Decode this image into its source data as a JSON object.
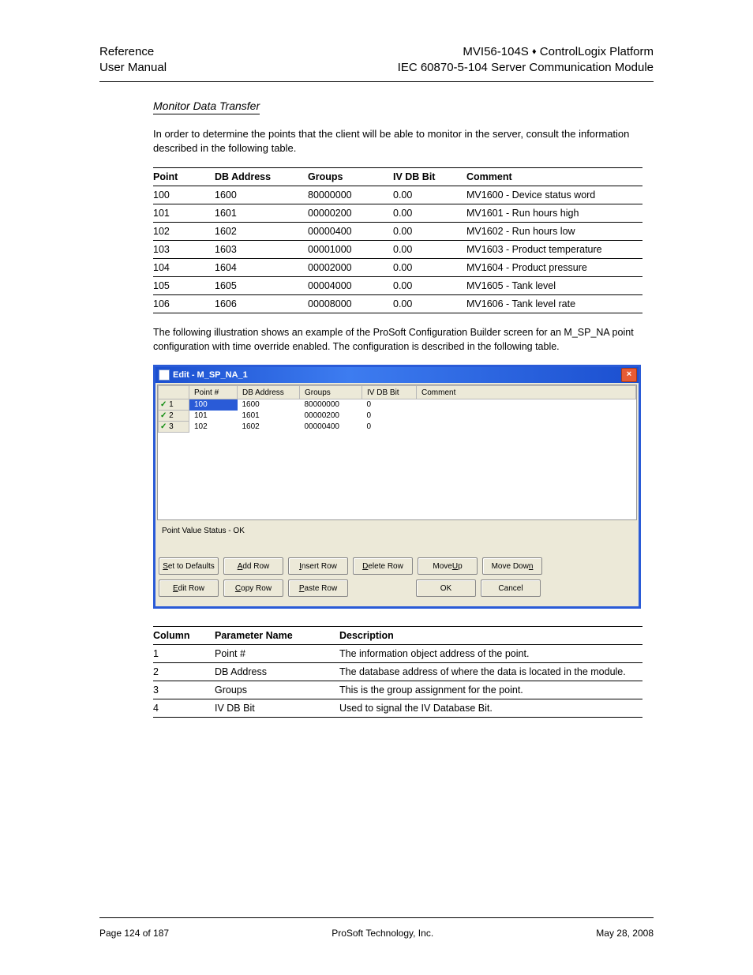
{
  "header": {
    "left1": "Reference",
    "left2": "User Manual",
    "right1_a": "MVI56-104S",
    "right1_diamond": "♦",
    "right1_b": "ControlLogix Platform",
    "right2": "IEC 60870-5-104 Server Communication Module"
  },
  "section_title": "Monitor Data Transfer",
  "para1": "In order to determine the points that the client will be able to monitor in the server, consult the information described in the following table.",
  "table1": {
    "headers": [
      "Point",
      "DB Address",
      "Groups",
      "IV DB Bit",
      "Comment"
    ],
    "rows": [
      [
        "100",
        "1600",
        "80000000",
        "0.00",
        "MV1600 - Device status word"
      ],
      [
        "101",
        "1601",
        "00000200",
        "0.00",
        "MV1601 - Run hours high"
      ],
      [
        "102",
        "1602",
        "00000400",
        "0.00",
        "MV1602 - Run hours low"
      ],
      [
        "103",
        "1603",
        "00001000",
        "0.00",
        "MV1603 - Product temperature"
      ],
      [
        "104",
        "1604",
        "00002000",
        "0.00",
        "MV1604 - Product pressure"
      ],
      [
        "105",
        "1605",
        "00004000",
        "0.00",
        "MV1605 - Tank level"
      ],
      [
        "106",
        "1606",
        "00008000",
        "0.00",
        "MV1606 - Tank level rate"
      ]
    ]
  },
  "footnote1": "The following illustration shows an example of the ProSoft Configuration Builder screen for an M_SP_NA point configuration with time override enabled. The configuration is described in the following table.",
  "window": {
    "title": "Edit - M_SP_NA_1",
    "columns": [
      "",
      "Point #",
      "DB Address",
      "Groups",
      "IV DB Bit",
      "Comment"
    ],
    "rows": [
      {
        "idx": "1",
        "point": "100",
        "db": "1600",
        "groups": "80000000",
        "iv": "0",
        "comment": "",
        "selected": true
      },
      {
        "idx": "2",
        "point": "101",
        "db": "1601",
        "groups": "00000200",
        "iv": "0",
        "comment": ""
      },
      {
        "idx": "3",
        "point": "102",
        "db": "1602",
        "groups": "00000400",
        "iv": "0",
        "comment": ""
      }
    ],
    "status": "Point Value Status - OK",
    "buttons_row1": [
      "Set to Defaults",
      "Add Row",
      "Insert Row",
      "Delete Row",
      "Move Up",
      "Move Down"
    ],
    "buttons_row2": [
      "Edit Row",
      "Copy Row",
      "Paste Row",
      "",
      "OK",
      "Cancel"
    ]
  },
  "table2": {
    "headers": [
      "Column",
      "Parameter Name",
      "Description"
    ],
    "rows": [
      [
        "1",
        "Point #",
        "The information object address of the point."
      ],
      [
        "2",
        "DB Address",
        "The database address of where the data is located in the module."
      ],
      [
        "3",
        "Groups",
        "This is the group assignment for the point."
      ],
      [
        "4",
        "IV DB Bit",
        "Used to signal the IV Database Bit."
      ]
    ]
  },
  "footer": {
    "left": "Page 124 of 187",
    "mid": "ProSoft Technology, Inc.",
    "right": "May 28, 2008"
  }
}
